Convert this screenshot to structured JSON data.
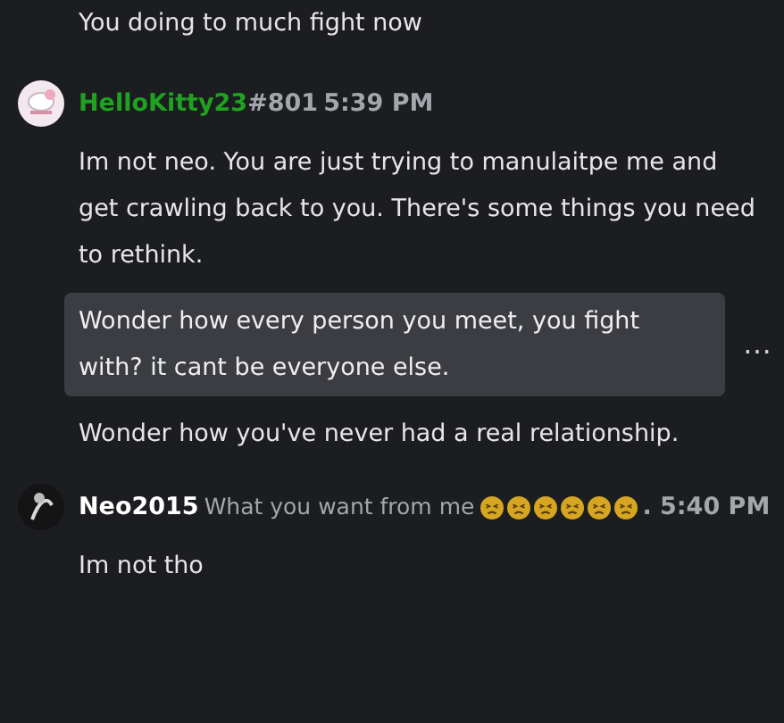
{
  "messages": [
    {
      "kind": "continuation",
      "paragraphs": [
        {
          "text": "You doing to much fight now",
          "highlighted": false
        }
      ]
    },
    {
      "kind": "group",
      "author": {
        "name": "HelloKitty23",
        "color": "#1fa21f",
        "tag": "#801",
        "time": "5:39 PM"
      },
      "paragraphs": [
        {
          "text": "Im not neo. You are just trying to manulaitpe me and get crawling back to you. There's some things you need to rethink.",
          "highlighted": false
        },
        {
          "text": "Wonder how every person you meet, you fight with? it cant be everyone else.",
          "highlighted": true,
          "menu": "…"
        },
        {
          "text": "Wonder how you've never had a real relationship.",
          "highlighted": false
        }
      ]
    },
    {
      "kind": "group",
      "author": {
        "name": "Neo2015",
        "color": "#ffffff",
        "status": "What you want from me",
        "time": ". 5:40 PM"
      },
      "paragraphs": [
        {
          "text": "Im not tho",
          "highlighted": false
        }
      ]
    }
  ]
}
